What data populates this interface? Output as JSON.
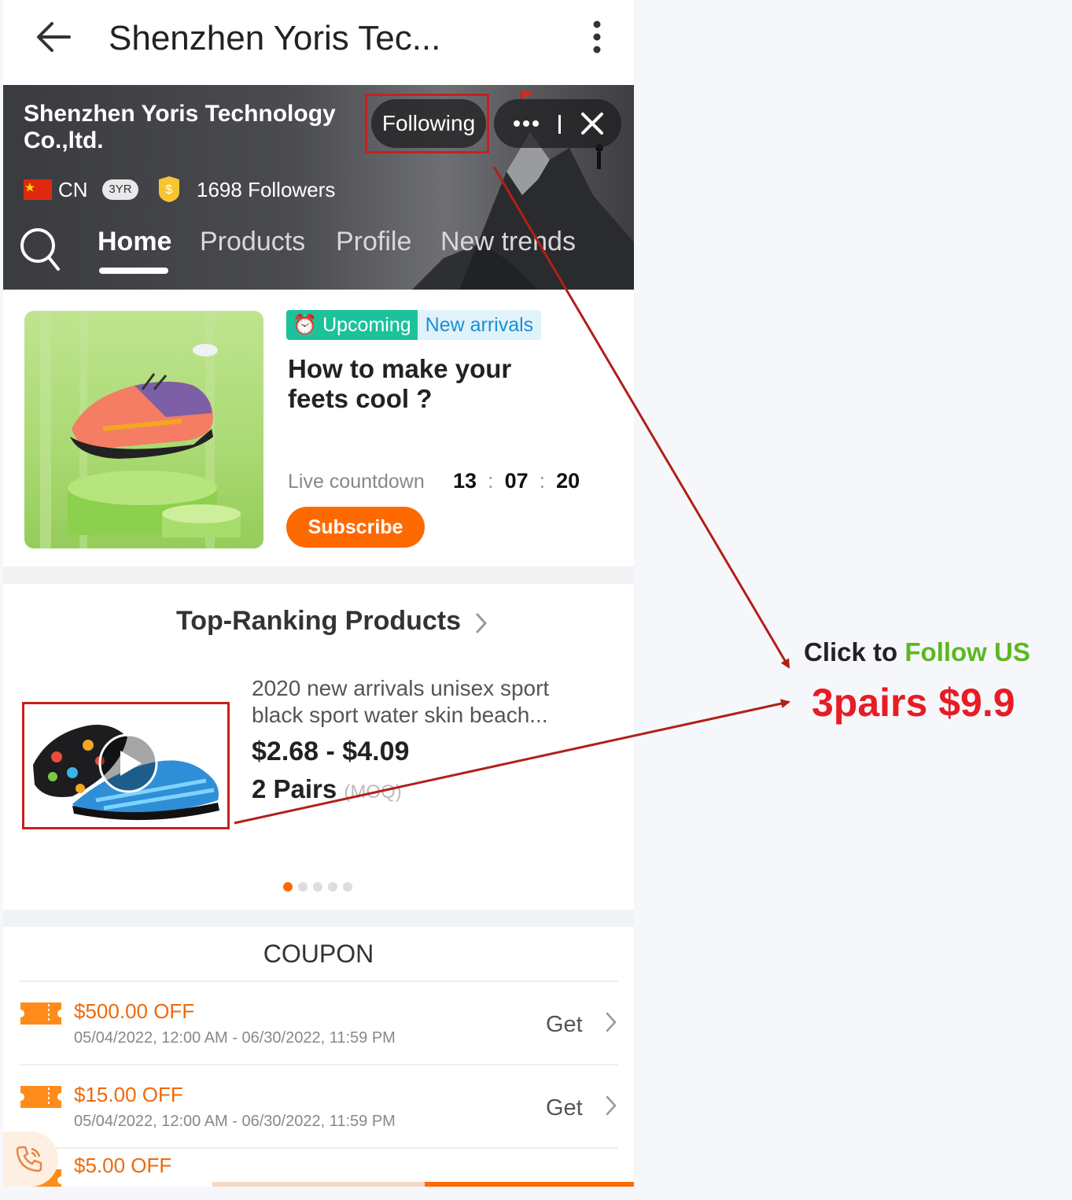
{
  "app_bar": {
    "title": "Shenzhen Yoris Tec..."
  },
  "store": {
    "name": "Shenzhen Yoris Technology Co.,ltd.",
    "follow_label": "Following",
    "country": "CN",
    "years_badge": "3YR",
    "followers": "1698 Followers",
    "tabs": [
      {
        "label": "Home",
        "active": true
      },
      {
        "label": "Products",
        "active": false
      },
      {
        "label": "Profile",
        "active": false
      },
      {
        "label": "New trends",
        "active": false
      }
    ]
  },
  "live": {
    "badge_upcoming": "Upcoming",
    "badge_new": "New arrivals",
    "title": "How to make your feets cool ?",
    "countdown_label": "Live countdown",
    "countdown": {
      "h": "13",
      "m": "07",
      "s": "20"
    },
    "subscribe_label": "Subscribe"
  },
  "ranking": {
    "title": "Top-Ranking Products",
    "product": {
      "desc_line1": "2020 new arrivals unisex sport",
      "desc_line2": "black sport water skin beach...",
      "price": "$2.68 - $4.09",
      "moq_value": "2 Pairs",
      "moq_label": "(MOQ)"
    },
    "pager": {
      "count": 5,
      "active": 0
    }
  },
  "coupons": {
    "title": "COUPON",
    "items": [
      {
        "amount": "$500.00 OFF",
        "dates": "05/04/2022, 12:00 AM - 06/30/2022, 11:59 PM",
        "action": "Get"
      },
      {
        "amount": "$15.00 OFF",
        "dates": "05/04/2022, 12:00 AM - 06/30/2022, 11:59 PM",
        "action": "Get"
      },
      {
        "amount": "$5.00 OFF",
        "dates": "",
        "action": ""
      }
    ]
  },
  "annotation": {
    "click_to": "Click to",
    "follow_us": "Follow US",
    "promo": "3pairs $9.9"
  },
  "colors": {
    "accent_orange": "#ff6a00",
    "highlight_red": "#c8201c",
    "promo_red": "#e81c24",
    "follow_green": "#5ab820",
    "upcoming_teal": "#1bc29a"
  }
}
